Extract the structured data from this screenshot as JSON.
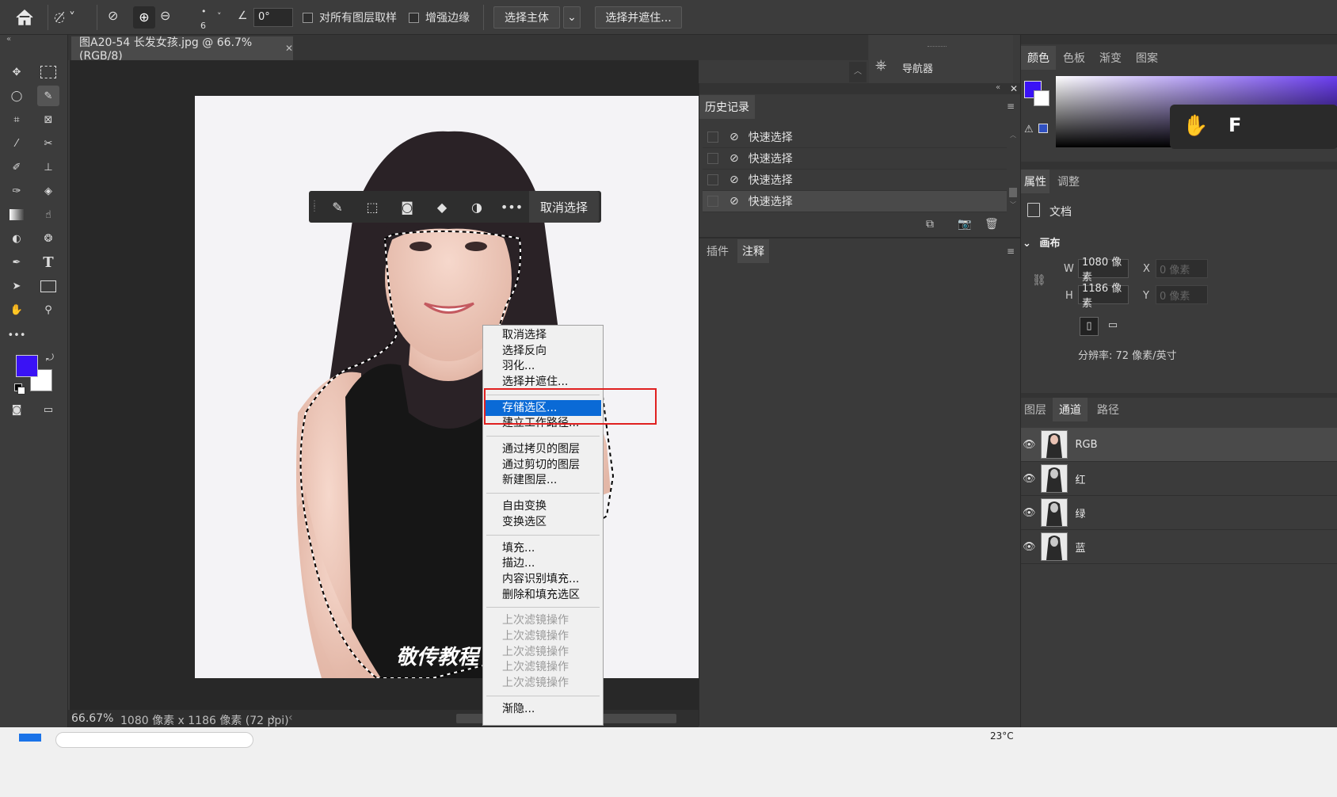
{
  "options_bar": {
    "brush_size": "6",
    "angle_value": "0°",
    "sample_all_layers": "对所有图层取样",
    "enhance_edge": "增强边缘",
    "select_subject": "选择主体",
    "select_and_mask": "选择并遮住..."
  },
  "document": {
    "tab_title": "图A20-54 长发女孩.jpg @ 66.7%(RGB/8)",
    "zoom": "66.67%",
    "info": "1080 像素 x 1186 像素 (72 ppi)"
  },
  "quick_bar": {
    "deselect_label": "取消选择"
  },
  "context_menu": {
    "groups": [
      [
        "取消选择",
        "选择反向",
        "羽化...",
        "选择并遮住..."
      ],
      [
        "存储选区...",
        "建立工作路径..."
      ],
      [
        "通过拷贝的图层",
        "通过剪切的图层",
        "新建图层..."
      ],
      [
        "自由变换",
        "变换选区"
      ],
      [
        "填充...",
        "描边...",
        "内容识别填充...",
        "删除和填充选区"
      ],
      [
        "上次滤镜操作",
        "上次滤镜操作",
        "上次滤镜操作",
        "上次滤镜操作",
        "上次滤镜操作"
      ],
      [
        "渐隐..."
      ]
    ],
    "highlighted": "存储选区..."
  },
  "navigator": {
    "label": "导航器"
  },
  "history": {
    "tab": "历史记录",
    "items": [
      "快速选择",
      "快速选择",
      "快速选择",
      "快速选择"
    ]
  },
  "lower_tabs": {
    "plugins": "插件",
    "notes": "注释"
  },
  "color_panel": {
    "tabs": [
      "颜色",
      "色板",
      "渐变",
      "图案"
    ],
    "foreground": "#3a12f5",
    "background": "#ffffff"
  },
  "properties": {
    "tabs": [
      "属性",
      "调整"
    ],
    "doc_label": "文档",
    "canvas_label": "画布",
    "w_label": "W",
    "h_label": "H",
    "x_label": "X",
    "y_label": "Y",
    "width": "1080 像素",
    "height": "1186 像素",
    "x_placeholder": "0 像素",
    "y_placeholder": "0 像素",
    "resolution": "分辨率: 72 像素/英寸"
  },
  "layers_panel": {
    "tabs": [
      "图层",
      "通道",
      "路径"
    ],
    "channels": [
      "RGB",
      "红",
      "绿",
      "蓝"
    ]
  },
  "canvas_watermark": "敬传教程",
  "taskbar": {
    "temperature": "23°C"
  }
}
